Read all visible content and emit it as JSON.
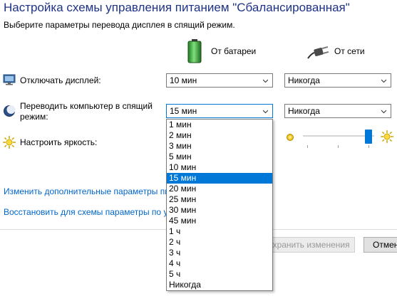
{
  "header": {
    "title": "Настройка схемы управления питанием \"Сбалансированная\"",
    "subtitle": "Выберите параметры перевода дисплея в спящий режим."
  },
  "columns": {
    "battery_label": "От батареи",
    "plugged_label": "От сети"
  },
  "settings": {
    "display_off": {
      "label": "Отключать дисплей:",
      "battery_value": "10 мин",
      "plugged_value": "Никогда"
    },
    "sleep": {
      "label": "Переводить компьютер в спящий режим:",
      "battery_value": "15 мин",
      "plugged_value": "Никогда"
    },
    "brightness": {
      "label": "Настроить яркость:",
      "plugged_level_percent": 93
    }
  },
  "links": {
    "advanced": "Изменить дополнительные параметры пи",
    "restore": "Восстановить для схемы параметры по ум"
  },
  "buttons": {
    "save": "Сохранить изменения",
    "cancel": "Отмен"
  },
  "dropdown": {
    "selected": "15 мин",
    "options": [
      "1 мин",
      "2 мин",
      "3 мин",
      "5 мин",
      "10 мин",
      "15 мин",
      "20 мин",
      "25 мин",
      "30 мин",
      "45 мин",
      "1 ч",
      "2 ч",
      "3 ч",
      "4 ч",
      "5 ч",
      "Никогда"
    ]
  },
  "colors": {
    "title": "#1e3287",
    "link": "#0066cc",
    "accent": "#0078d7"
  },
  "icons": {
    "battery": "battery-icon",
    "plug": "power-plug-icon",
    "display": "monitor-icon",
    "sleep": "moon-icon",
    "brightness": "sun-icon"
  }
}
